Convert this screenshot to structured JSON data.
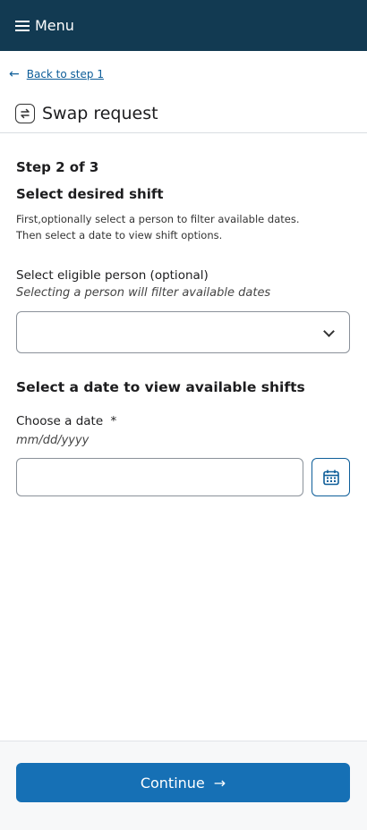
{
  "header": {
    "menu_label": "Menu"
  },
  "nav": {
    "back_label": "Back to step 1",
    "back_arrow": "←"
  },
  "page": {
    "title": "Swap request"
  },
  "form": {
    "step": "Step 2 of 3",
    "subheading": "Select desired shift",
    "help_line1": "First,optionally select a person to filter available dates.",
    "help_line2": "Then select a date to view shift options.",
    "person_label": "Select eligible person (optional)",
    "person_hint": "Selecting a person will filter available dates",
    "person_value": "",
    "date_section": "Select a date to view available shifts",
    "date_label": "Choose a date",
    "date_required": "*",
    "date_hint": "mm/dd/yyyy",
    "date_value": ""
  },
  "footer": {
    "continue_label": "Continue",
    "continue_arrow": "→"
  },
  "colors": {
    "header_bg": "#123a52",
    "primary": "#1670b5",
    "link": "#0e5e99"
  },
  "icons": [
    "hamburger-icon",
    "back-arrow-icon",
    "swap-icon",
    "chevron-down-icon",
    "calendar-icon",
    "arrow-right-icon"
  ]
}
